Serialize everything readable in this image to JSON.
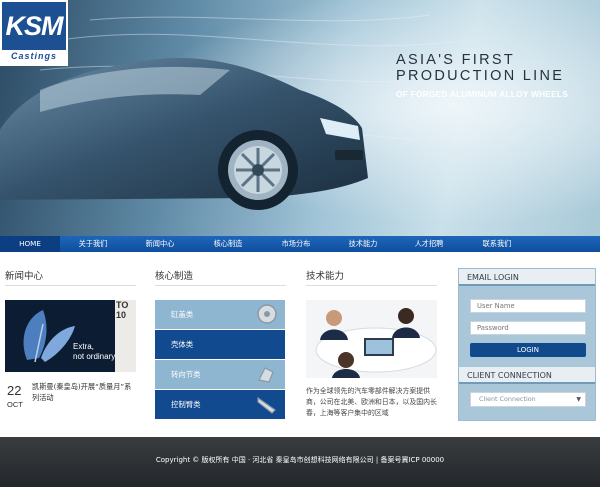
{
  "brand": {
    "logo_text": "KSM",
    "logo_sub": "Castings"
  },
  "hero": {
    "line1": "ASIA'S FIRST",
    "line2": "PRODUCTION LINE",
    "line3": "OF FORGED ALUMINUM ALLOY WHEELS"
  },
  "nav": {
    "items": [
      {
        "label": "HOME",
        "active": true
      },
      {
        "label": "关于我们"
      },
      {
        "label": "新闻中心"
      },
      {
        "label": "核心制造"
      },
      {
        "label": "市场分布"
      },
      {
        "label": "技术能力"
      },
      {
        "label": "人才招聘"
      },
      {
        "label": "联系我们"
      }
    ]
  },
  "news": {
    "title": "新闻中心",
    "image_caption_1": "Extra,",
    "image_caption_2": "not ordinary.",
    "image_brand": "TO\n10",
    "date_day": "22",
    "date_month": "OCT",
    "headline": "凯斯曼(秦皇岛)开展“质量月”系列活动"
  },
  "core": {
    "title": "核心制造",
    "items": [
      {
        "label": "缸盖类",
        "color": "#8fb6d1"
      },
      {
        "label": "壳体类",
        "color": "#114a8f"
      },
      {
        "label": "转向节类",
        "color": "#8fb6d1"
      },
      {
        "label": "控制臂类",
        "color": "#114a8f"
      }
    ]
  },
  "tech": {
    "title": "技术能力",
    "text": "作为全球领先的汽车零部件解决方案提供商，公司在北美、欧洲和日本，以及国内长春，上海等客户集中的区域"
  },
  "sidebar": {
    "login_title": "EMAIL LOGIN",
    "user_placeholder": "User Name",
    "pass_placeholder": "Password",
    "login_button": "LOGIN",
    "client_title": "CLIENT CONNECTION",
    "client_select": "Client Connection"
  },
  "footer": {
    "text": "Copyright © 版权所有 中国 · 河北省 秦皇岛市创想科技网络有限公司 | 备案号冀ICP 00000"
  },
  "colors": {
    "nav": "#165aa9",
    "accent": "#114a8f",
    "footer": "#2d3033"
  }
}
